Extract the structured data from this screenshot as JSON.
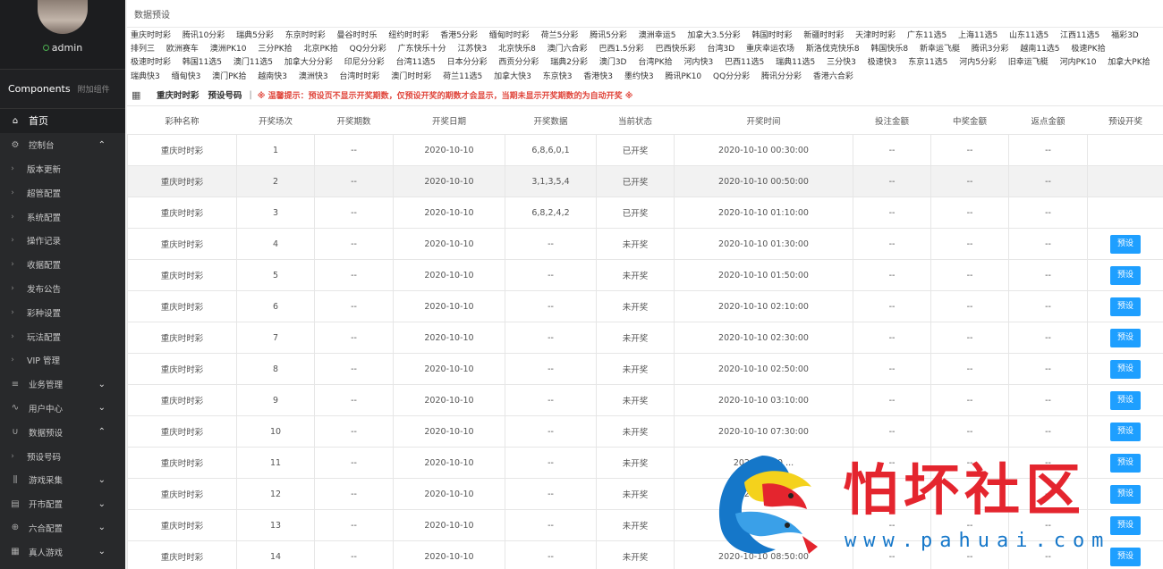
{
  "user": {
    "name": "admin"
  },
  "components": {
    "title": "Components",
    "subtitle": "附加组件"
  },
  "nav": [
    {
      "label": "首页",
      "icon": "home-icon",
      "type": "home"
    },
    {
      "label": "控制台",
      "icon": "settings-icon",
      "type": "group",
      "chev": "^"
    },
    {
      "label": "版本更新",
      "type": "sub"
    },
    {
      "label": "超管配置",
      "type": "sub"
    },
    {
      "label": "系统配置",
      "type": "sub"
    },
    {
      "label": "操作记录",
      "type": "sub"
    },
    {
      "label": "收据配置",
      "type": "sub"
    },
    {
      "label": "发布公告",
      "type": "sub"
    },
    {
      "label": "彩种设置",
      "type": "sub"
    },
    {
      "label": "玩法配置",
      "type": "sub"
    },
    {
      "label": "VIP 管理",
      "type": "sub"
    },
    {
      "label": "业务管理",
      "icon": "list-icon",
      "type": "group",
      "chev": "v"
    },
    {
      "label": "用户中心",
      "icon": "pulse-icon",
      "type": "group",
      "chev": "v"
    },
    {
      "label": "数据预设",
      "icon": "magnet-icon",
      "type": "group",
      "chev": "^"
    },
    {
      "label": "预设号码",
      "type": "sub"
    },
    {
      "label": "游戏采集",
      "icon": "columns-icon",
      "type": "group",
      "chev": "v"
    },
    {
      "label": "开市配置",
      "icon": "calendar-icon",
      "type": "group",
      "chev": "v"
    },
    {
      "label": "六合配置",
      "icon": "globe-icon",
      "type": "group",
      "chev": "v"
    },
    {
      "label": "真人游戏",
      "icon": "grid-icon",
      "type": "group",
      "chev": "v"
    }
  ],
  "page": {
    "title": "数据预设"
  },
  "lotteries": [
    "重庆时时彩",
    "腾讯10分彩",
    "瑞典5分彩",
    "东京时时彩",
    "曼谷时时乐",
    "纽约时时彩",
    "香港5分彩",
    "缅甸时时彩",
    "荷兰5分彩",
    "腾讯5分彩",
    "澳洲幸运5",
    "加拿大3.5分彩",
    "韩国时时彩",
    "新疆时时彩",
    "天津时时彩",
    "广东11选5",
    "上海11选5",
    "山东11选5",
    "江西11选5",
    "福彩3D",
    "排列三",
    "欧洲赛车",
    "澳洲PK10",
    "三分PK拾",
    "北京PK拾",
    "QQ分分彩",
    "广东快乐十分",
    "江苏快3",
    "北京快乐8",
    "澳门六合彩",
    "巴西1.5分彩",
    "巴西快乐彩",
    "台湾3D",
    "重庆幸运农场",
    "斯洛伐克快乐8",
    "韩国快乐8",
    "新幸运飞艇",
    "腾讯3分彩",
    "越南11选5",
    "极速PK拾",
    "极速时时彩",
    "韩国11选5",
    "澳门11选5",
    "加拿大分分彩",
    "印尼分分彩",
    "台湾11选5",
    "日本分分彩",
    "西贡分分彩",
    "瑞典2分彩",
    "澳门3D",
    "台湾PK拾",
    "河内快3",
    "巴西11选5",
    "瑞典11选5",
    "三分快3",
    "极速快3",
    "东京11选5",
    "河内5分彩",
    "旧幸运飞艇",
    "河内PK10",
    "加拿大PK拾",
    "瑞典快3",
    "缅甸快3",
    "澳门PK拾",
    "越南快3",
    "澳洲快3",
    "台湾时时彩",
    "澳门时时彩",
    "荷兰11选5",
    "加拿大快3",
    "东京快3",
    "香港快3",
    "墨约快3",
    "腾讯PK10",
    "QQ分分彩",
    "腾讯分分彩",
    "香港六合彩"
  ],
  "toolbar": {
    "current_lottery": "重庆时时彩",
    "preset_code": "预设号码",
    "separator": "|",
    "warning": "※ 温馨提示：预设页不显示开奖期数，仅预设开奖的期数才会显示，当期未显示开奖期数的为自动开奖 ※"
  },
  "table": {
    "headers": [
      "彩种名称",
      "开奖场次",
      "开奖期数",
      "开奖日期",
      "开奖数据",
      "当前状态",
      "开奖时间",
      "投注金额",
      "中奖金额",
      "返点金额",
      "预设开奖"
    ],
    "button_label": "预设",
    "rows": [
      [
        "重庆时时彩",
        "1",
        "--",
        "2020-10-10",
        "6,8,6,0,1",
        "已开奖",
        "2020-10-10 00:30:00",
        "--",
        "--",
        "--",
        ""
      ],
      [
        "重庆时时彩",
        "2",
        "--",
        "2020-10-10",
        "3,1,3,5,4",
        "已开奖",
        "2020-10-10 00:50:00",
        "--",
        "--",
        "--",
        ""
      ],
      [
        "重庆时时彩",
        "3",
        "--",
        "2020-10-10",
        "6,8,2,4,2",
        "已开奖",
        "2020-10-10 01:10:00",
        "--",
        "--",
        "--",
        ""
      ],
      [
        "重庆时时彩",
        "4",
        "--",
        "2020-10-10",
        "--",
        "未开奖",
        "2020-10-10 01:30:00",
        "--",
        "--",
        "--",
        "btn"
      ],
      [
        "重庆时时彩",
        "5",
        "--",
        "2020-10-10",
        "--",
        "未开奖",
        "2020-10-10 01:50:00",
        "--",
        "--",
        "--",
        "btn"
      ],
      [
        "重庆时时彩",
        "6",
        "--",
        "2020-10-10",
        "--",
        "未开奖",
        "2020-10-10 02:10:00",
        "--",
        "--",
        "--",
        "btn"
      ],
      [
        "重庆时时彩",
        "7",
        "--",
        "2020-10-10",
        "--",
        "未开奖",
        "2020-10-10 02:30:00",
        "--",
        "--",
        "--",
        "btn"
      ],
      [
        "重庆时时彩",
        "8",
        "--",
        "2020-10-10",
        "--",
        "未开奖",
        "2020-10-10 02:50:00",
        "--",
        "--",
        "--",
        "btn"
      ],
      [
        "重庆时时彩",
        "9",
        "--",
        "2020-10-10",
        "--",
        "未开奖",
        "2020-10-10 03:10:00",
        "--",
        "--",
        "--",
        "btn"
      ],
      [
        "重庆时时彩",
        "10",
        "--",
        "2020-10-10",
        "--",
        "未开奖",
        "2020-10-10 07:30:00",
        "--",
        "--",
        "--",
        "btn"
      ],
      [
        "重庆时时彩",
        "11",
        "--",
        "2020-10-10",
        "--",
        "未开奖",
        "2020-10-10 ...",
        "--",
        "--",
        "--",
        "btn"
      ],
      [
        "重庆时时彩",
        "12",
        "--",
        "2020-10-10",
        "--",
        "未开奖",
        "2020-10-10 ...",
        "--",
        "--",
        "--",
        "btn"
      ],
      [
        "重庆时时彩",
        "13",
        "--",
        "2020-10-10",
        "--",
        "未开奖",
        "2020-10-10 ...",
        "--",
        "--",
        "--",
        "btn"
      ],
      [
        "重庆时时彩",
        "14",
        "--",
        "2020-10-10",
        "--",
        "未开奖",
        "2020-10-10 08:50:00",
        "--",
        "--",
        "--",
        "btn"
      ]
    ]
  },
  "watermark": {
    "text": "怕坏社区",
    "url": "www.pahuai.com"
  },
  "colors": {
    "sidebar_bg": "#28292b",
    "button_blue": "#1e9fff",
    "warning_red": "#e0463c",
    "watermark_red": "#e4252e"
  }
}
